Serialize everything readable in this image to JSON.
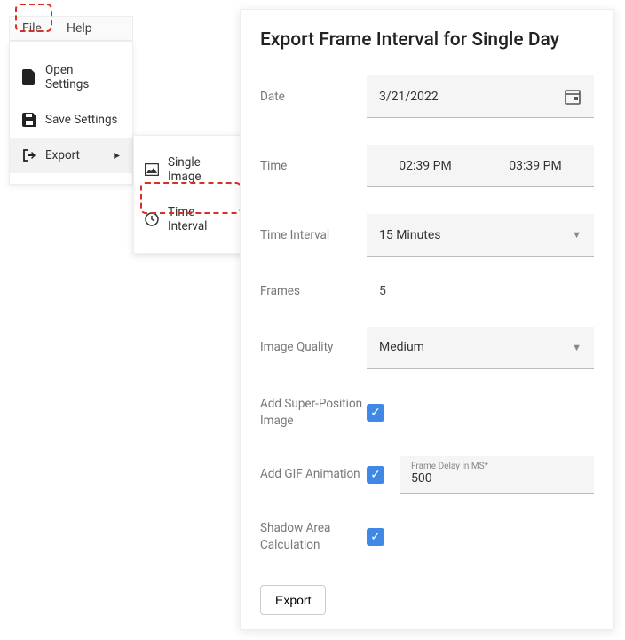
{
  "menubar": {
    "file": "File",
    "help": "Help"
  },
  "dropdown": {
    "open": "Open Settings",
    "save": "Save Settings",
    "export": "Export"
  },
  "submenu": {
    "single": "Single Image",
    "time": "Time Interval"
  },
  "dialog": {
    "title": "Export Frame Interval for Single Day",
    "date_label": "Date",
    "date_value": "3/21/2022",
    "time_label": "Time",
    "time_start": "02:39 PM",
    "time_end": "03:39 PM",
    "interval_label": "Time Interval",
    "interval_value": "15 Minutes",
    "frames_label": "Frames",
    "frames_value": "5",
    "quality_label": "Image Quality",
    "quality_value": "Medium",
    "super_label": "Add Super-Position Image",
    "gif_label": "Add GIF Animation",
    "frame_delay_label": "Frame Delay in MS*",
    "frame_delay_value": "500",
    "shadow_label": "Shadow Area Calculation",
    "export_btn": "Export"
  }
}
